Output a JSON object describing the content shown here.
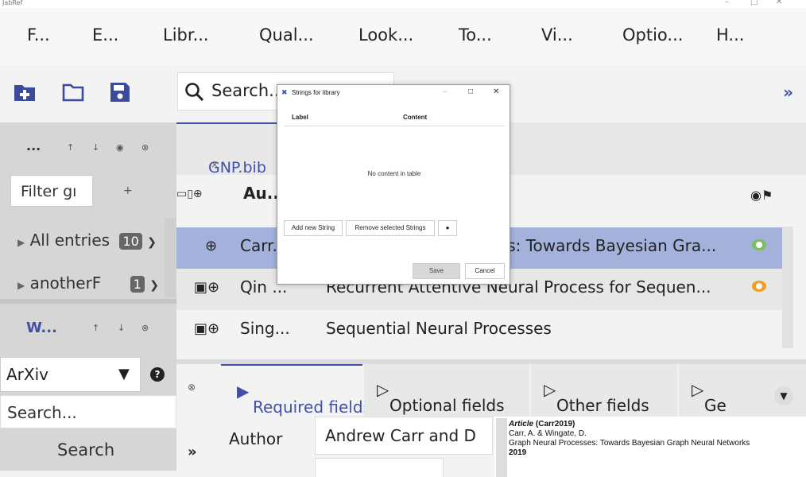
{
  "window": {
    "title": "JabRef",
    "controls": [
      "–",
      "□",
      "✕"
    ]
  },
  "menu": [
    "F...",
    "E...",
    "Libr...",
    "Qual...",
    "Look...",
    "To...",
    "Vi...",
    "Optio...",
    "H..."
  ],
  "toolbar": {
    "search_placeholder": "Search...",
    "more": "»"
  },
  "groups": {
    "title": "...",
    "controls": [
      "↑",
      "↓",
      "◉",
      "⊗"
    ],
    "filter_placeholder": "Filter gı",
    "add": "+",
    "items": [
      {
        "label": "All entries",
        "count": "10"
      },
      {
        "label": "anotherF",
        "count": "1"
      }
    ]
  },
  "web_search": {
    "title": "W...",
    "controls": [
      "↑",
      "↓",
      "⊗"
    ],
    "fetcher": "ArXiv",
    "search_placeholder": "Search...",
    "search_button": "Search"
  },
  "library_tab": {
    "label": "GNP.bib",
    "close": "×"
  },
  "table": {
    "header_author": "Au..",
    "rows": [
      {
        "author": "Carr...",
        "title": "Graph Neural Processes: Towards Bayesian Gra...",
        "selected": true,
        "eye_color": "#7cc05a"
      },
      {
        "author": "Qin ...",
        "title": "Recurrent Attentive Neural Process for Sequen...",
        "selected": false,
        "eye_color": "#f0a020"
      },
      {
        "author": "Sing...",
        "title": "Sequential Neural Processes",
        "selected": false,
        "eye_color": ""
      }
    ]
  },
  "editor": {
    "tabs": [
      "Required fields",
      "Optional fields",
      "Other fields",
      "Ge"
    ],
    "close": "⊗",
    "expand": "»",
    "author_label": "Author",
    "author_value": "Andrew Carr and D",
    "preview": {
      "line1_type": "Article",
      "line1_key": "(Carr2019)",
      "line2": "Carr, A. & Wingate, D.",
      "line3": "Graph Neural Processes: Towards Bayesian Graph Neural Networks",
      "line4": "2019"
    }
  },
  "dialog": {
    "title": "Strings for library",
    "col_label": "Label",
    "col_content": "Content",
    "empty": "No content in table",
    "add_button": "Add new String",
    "remove_button": "Remove selected Strings",
    "save_button": "Save",
    "cancel_button": "Cancel"
  },
  "colors": {
    "accent": "#4050a8",
    "selected_row": "#a3b1db"
  }
}
